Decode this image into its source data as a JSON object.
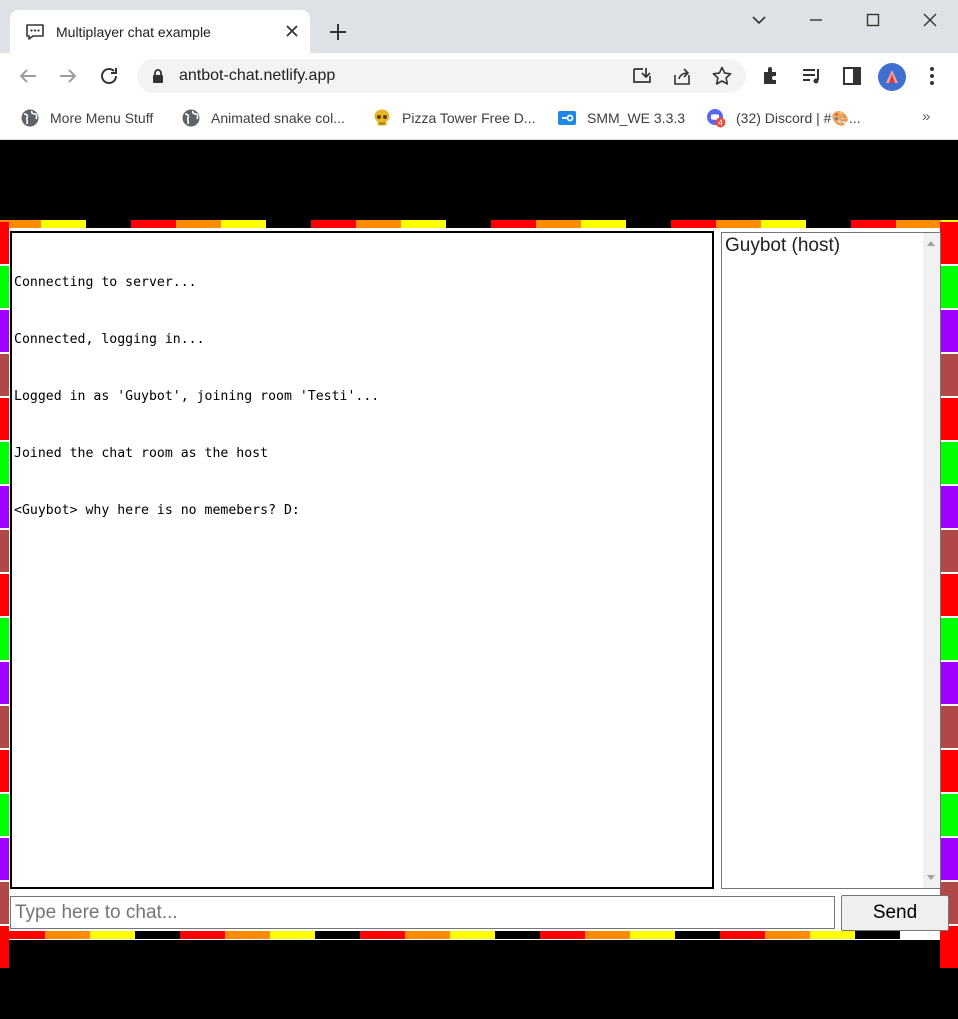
{
  "browser": {
    "tab": {
      "title": "Multiplayer chat example"
    },
    "address": {
      "url": "antbot-chat.netlify.app"
    },
    "bookmarks": [
      {
        "label": "More Menu Stuff",
        "icon": "globe-icon"
      },
      {
        "label": "Animated snake col...",
        "icon": "globe-icon"
      },
      {
        "label": "Pizza Tower Free D...",
        "icon": "skull-icon"
      },
      {
        "label": "SMM_WE 3.3.3",
        "icon": "smm-icon"
      },
      {
        "label": "(32) Discord | #🎨...",
        "icon": "discord-icon"
      }
    ],
    "bookmarks_overflow": "»"
  },
  "chat": {
    "lines": [
      "Connecting to server...",
      "Connected, logging in...",
      "Logged in as 'Guybot', joining room 'Testi'...",
      "Joined the chat room as the host",
      "<Guybot> why here is no memebers? D:"
    ],
    "users": [
      "Guybot (host)"
    ],
    "input": {
      "placeholder": "Type here to chat...",
      "value": ""
    },
    "send_label": "Send"
  },
  "colors": {
    "stripe_cycle": [
      "#ff0000",
      "#ff8c00",
      "#ffff00",
      "#000000"
    ],
    "side_cycle": [
      "#ff0000",
      "#00ff00",
      "#a000ff",
      "#b04848"
    ],
    "discord_badge": "#e74c3c",
    "profile_avatar": "#3f6fcf"
  }
}
